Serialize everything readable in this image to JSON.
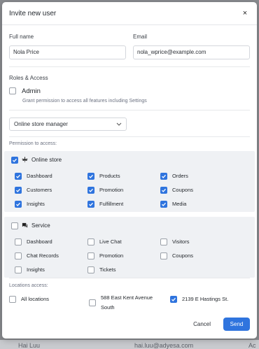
{
  "modal": {
    "title": "Invite new user",
    "close_label": "×"
  },
  "form": {
    "full_name_label": "Full name",
    "full_name_value": "Nola Price",
    "email_label": "Email",
    "email_value": "nola_wprice@example.com"
  },
  "roles": {
    "heading": "Roles & Access",
    "admin_label": "Admin",
    "admin_checked": false,
    "admin_desc": "Grant permission to access all features including Settings",
    "role_select": "Online store manager"
  },
  "permissions": {
    "label": "Permission to access:",
    "groups": [
      {
        "name": "Online store",
        "icon": "cannabis-leaf-icon",
        "checked": true,
        "items": [
          {
            "label": "Dashboard",
            "checked": true
          },
          {
            "label": "Products",
            "checked": true
          },
          {
            "label": "Orders",
            "checked": true
          },
          {
            "label": "Customers",
            "checked": true
          },
          {
            "label": "Promotion",
            "checked": true
          },
          {
            "label": "Coupons",
            "checked": true
          },
          {
            "label": "Insights",
            "checked": true
          },
          {
            "label": "Fulfillment",
            "checked": true
          },
          {
            "label": "Media",
            "checked": true
          }
        ]
      },
      {
        "name": "Service",
        "icon": "chat-icon",
        "checked": false,
        "items": [
          {
            "label": "Dashboard",
            "checked": false
          },
          {
            "label": "Live Chat",
            "checked": false
          },
          {
            "label": "Visitors",
            "checked": false
          },
          {
            "label": "Chat Records",
            "checked": false
          },
          {
            "label": "Promotion",
            "checked": false
          },
          {
            "label": "Coupons",
            "checked": false
          },
          {
            "label": "Insights",
            "checked": false
          },
          {
            "label": "Tickets",
            "checked": false
          }
        ]
      }
    ]
  },
  "locations": {
    "label": "Locations access:",
    "items": [
      {
        "label": "All locations",
        "checked": false
      },
      {
        "label_line1": "588 East Kent Avenue",
        "label_line2": "South",
        "checked": false
      },
      {
        "label": "2139 E Hastings St.",
        "checked": true
      }
    ]
  },
  "footer": {
    "cancel_label": "Cancel",
    "send_label": "Send"
  },
  "backdrop": {
    "name": "Hai Luu",
    "email": "hai.luu@adyesa.com",
    "extra": "Ac"
  },
  "colors": {
    "accent": "#2f74de"
  }
}
